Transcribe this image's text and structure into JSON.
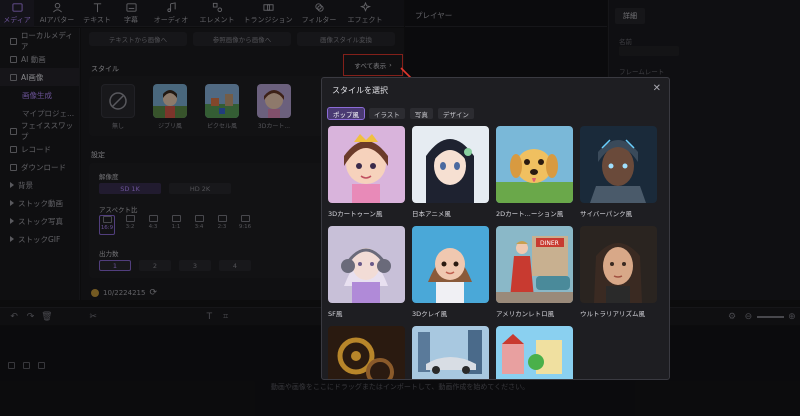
{
  "toolbar": {
    "items": [
      {
        "label": "メディア",
        "icon": "media-icon"
      },
      {
        "label": "AIアバター",
        "icon": "avatar-icon"
      },
      {
        "label": "テキスト",
        "icon": "text-icon"
      },
      {
        "label": "字幕",
        "icon": "subtitle-icon"
      },
      {
        "label": "オーディオ",
        "icon": "audio-icon"
      },
      {
        "label": "エレメント",
        "icon": "element-icon"
      },
      {
        "label": "トランジション",
        "icon": "transition-icon"
      },
      {
        "label": "フィルター",
        "icon": "filter-icon"
      },
      {
        "label": "エフェクト",
        "icon": "effect-icon"
      }
    ]
  },
  "sidebar": {
    "items": [
      {
        "label": "ローカルメディア"
      },
      {
        "label": "AI 動画"
      },
      {
        "label": "AI画像"
      },
      {
        "label": "画像生成"
      },
      {
        "label": "マイプロジェ..."
      },
      {
        "label": "フェイススワップ"
      },
      {
        "label": "レコード"
      },
      {
        "label": "ダウンロード"
      },
      {
        "label": "背景"
      },
      {
        "label": "ストック動画"
      },
      {
        "label": "ストック写真"
      },
      {
        "label": "ストックGIF"
      }
    ]
  },
  "main": {
    "tabs": [
      "テキストから画像へ",
      "参照画像から画像へ",
      "画像スタイル変換"
    ],
    "style_section": "スタイル",
    "see_all": "すべて表示",
    "styles": [
      "無し",
      "ジブリ風",
      "ピクセル風",
      "3Dカート..."
    ],
    "settings_section": "設定",
    "resolution_label": "解像度",
    "resolutions": [
      "SD 1K",
      "HD 2K"
    ],
    "aspect_label": "アスペクト比",
    "aspects": [
      "16:9",
      "3:2",
      "4:3",
      "1:1",
      "3:4",
      "2:3",
      "9:16"
    ],
    "count_label": "出力数",
    "counts": [
      "1",
      "2",
      "3",
      "4"
    ],
    "credits": "10/2224215"
  },
  "player": {
    "title": "プレイヤー"
  },
  "details": {
    "tab": "詳細",
    "name_label": "名前",
    "framerate_label": "フレームレート"
  },
  "timeline": {
    "hint": "動画や画像をここにドラッグまたはインポートして、動画作成を始めてください。"
  },
  "modal": {
    "title": "スタイルを選択",
    "chips": [
      "ポップ風",
      "イラスト",
      "写真",
      "デザイン"
    ],
    "cards": [
      {
        "label": "3Dカートゥーン風"
      },
      {
        "label": "日本アニメ風"
      },
      {
        "label": "2Dカート...ーション風"
      },
      {
        "label": "サイバーパンク風"
      },
      {
        "label": "SF風"
      },
      {
        "label": "3Dクレイ風"
      },
      {
        "label": "アメリカンレトロ風"
      },
      {
        "label": "ウルトラリアリズム風"
      },
      {
        "label": ""
      },
      {
        "label": ""
      },
      {
        "label": ""
      }
    ]
  },
  "colors": {
    "accent": "#b58cff",
    "highlight_box": "#e2372d",
    "selected_chip": "#4a3a73"
  }
}
